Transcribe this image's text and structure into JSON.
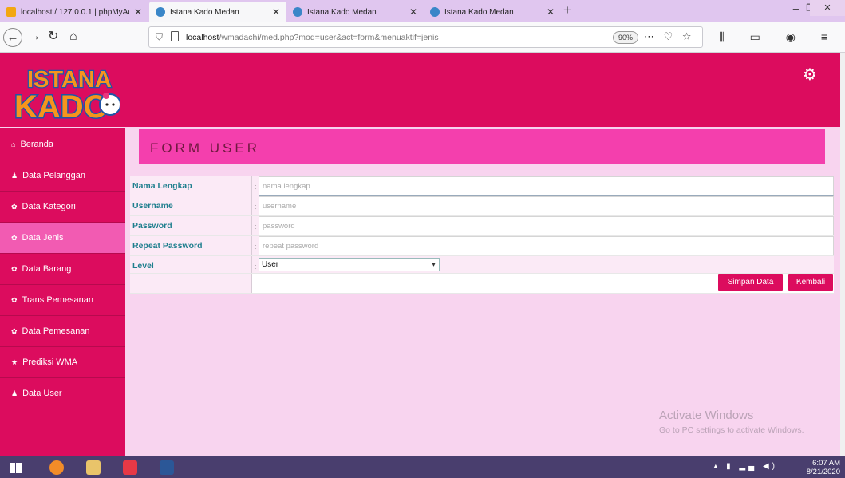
{
  "browser": {
    "tabs": [
      {
        "title": "localhost / 127.0.0.1 | phpMyAc"
      },
      {
        "title": "Istana Kado Medan"
      },
      {
        "title": "Istana Kado Medan"
      },
      {
        "title": "Istana Kado Medan"
      }
    ],
    "url_host": "localhost",
    "url_path": "/wmadachi/med.php?mod=user&act=form&menuaktif=jenis",
    "zoom": "90%"
  },
  "header": {
    "logo_line1": "ISTANA",
    "logo_line2": "KADO",
    "brand_color": "#dc0c5e"
  },
  "sidebar": {
    "items": [
      {
        "label": "Beranda",
        "icon": "home-icon",
        "glyph": "⌂"
      },
      {
        "label": "Data Pelanggan",
        "icon": "user-icon",
        "glyph": "♟"
      },
      {
        "label": "Data Kategori",
        "icon": "gears-icon",
        "glyph": "✿"
      },
      {
        "label": "Data Jenis",
        "icon": "gears-icon",
        "glyph": "✿"
      },
      {
        "label": "Data Barang",
        "icon": "gears-icon",
        "glyph": "✿"
      },
      {
        "label": "Trans Pemesanan",
        "icon": "gears-icon",
        "glyph": "✿"
      },
      {
        "label": "Data Pemesanan",
        "icon": "gears-icon",
        "glyph": "✿"
      },
      {
        "label": "Prediksi WMA",
        "icon": "star-icon",
        "glyph": "★"
      },
      {
        "label": "Data User",
        "icon": "user-icon",
        "glyph": "♟"
      }
    ],
    "active_index": 3
  },
  "main": {
    "title": "FORM USER",
    "fields": [
      {
        "label": "Nama Lengkap",
        "placeholder": "nama lengkap"
      },
      {
        "label": "Username",
        "placeholder": "username"
      },
      {
        "label": "Password",
        "placeholder": "password"
      },
      {
        "label": "Repeat Password",
        "placeholder": "repeat password"
      }
    ],
    "level": {
      "label": "Level",
      "value": "User"
    },
    "colon": ":",
    "buttons": {
      "save": "Simpan Data",
      "back": "Kembali"
    }
  },
  "watermark": {
    "line1": "Activate Windows",
    "line2": "Go to PC settings to activate Windows."
  },
  "taskbar": {
    "time": "6:07 AM",
    "date": "8/21/2020"
  }
}
